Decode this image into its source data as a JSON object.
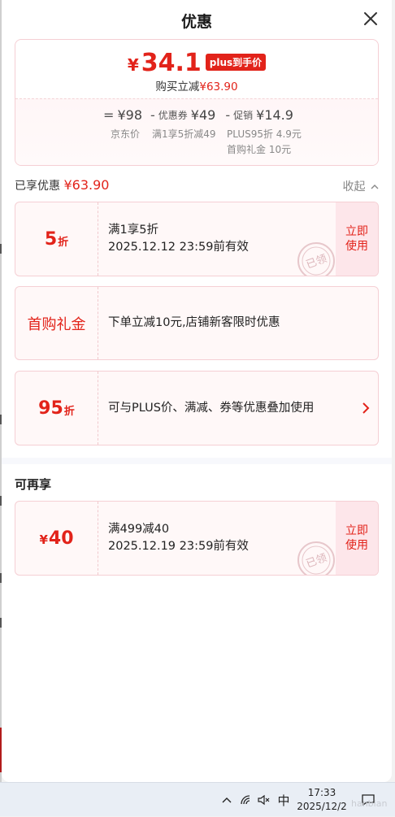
{
  "modal": {
    "title": "优惠"
  },
  "summary": {
    "currency": "¥",
    "final_price": "34.1",
    "plus_tag": "plus到手价",
    "instant_discount_label": "购买立减",
    "instant_discount_value": "¥63.90",
    "eq_sign": "=",
    "jd_price": "¥98",
    "minus1": "-",
    "coupon_label": "优惠券",
    "coupon_value": "¥49",
    "minus2": "-",
    "promo_label": "促销",
    "promo_value": "¥14.9",
    "jd_price_label": "京东价",
    "coupon_desc": "满1享5折减49",
    "plus_desc": "PLUS95折 4.9元",
    "gift_desc": "首购礼金 10元"
  },
  "enjoyed": {
    "label": "已享优惠",
    "value": "¥63.90",
    "collapse": "收起"
  },
  "cards": [
    {
      "big": "5",
      "unit": "折",
      "line1": "满1享5折",
      "line2": "2025.12.12 23:59前有效",
      "action": "立即\n使用",
      "stamp": "已领"
    },
    {
      "big": "首购礼金",
      "line1": "下单立减10元,店铺新客限时优惠"
    },
    {
      "big": "95",
      "unit": "折",
      "line1": "可与PLUS价、满减、券等优惠叠加使用"
    }
  ],
  "more": {
    "title": "可再享",
    "card": {
      "yen": "¥",
      "big": "40",
      "line1": "满499减40",
      "line2": "2025.12.19 23:59前有效",
      "action": "立即\n使用",
      "stamp": "已领"
    }
  },
  "taskbar": {
    "time": "17:33",
    "date": "2025/12/2",
    "ime": "中",
    "watermark": "hanbian"
  },
  "colors": {
    "accent": "#e2231a",
    "card_bg": "#fff8f8",
    "card_border": "#f5cfd4",
    "action_bg": "#fde6ea"
  }
}
